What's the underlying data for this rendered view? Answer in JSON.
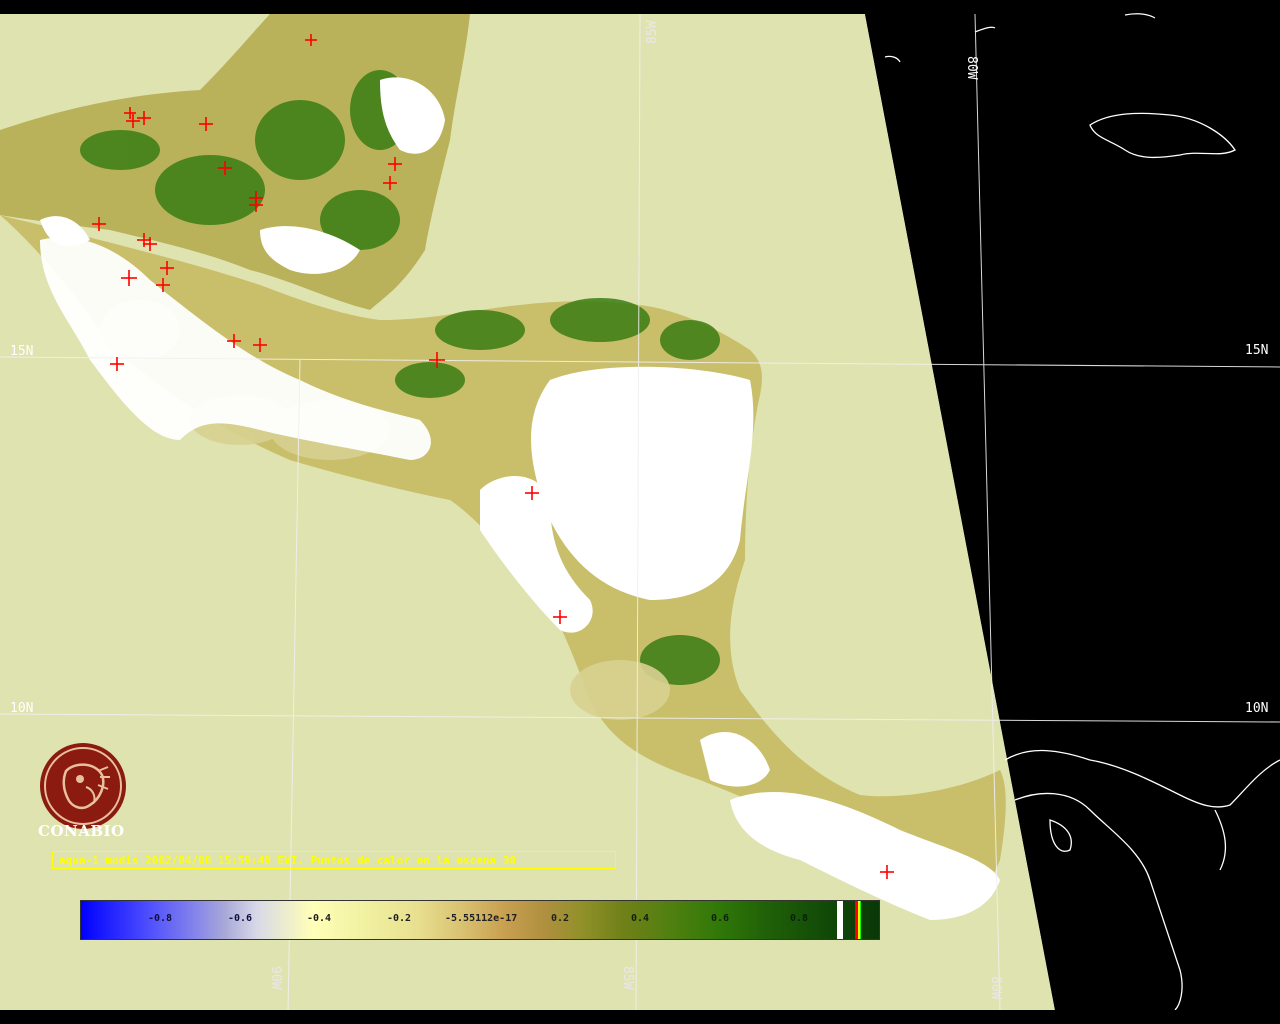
{
  "map": {
    "grid_labels": {
      "lat_15_left": "15N",
      "lat_15_right": "15N",
      "lat_10_left": "10N",
      "lat_10_right": "10N",
      "lon_85_top": "85W",
      "lon_80_top": "80W",
      "lon_90_bottom": "90W",
      "lon_85_bottom": "85W",
      "lon_80_bottom": "80W"
    },
    "colors": {
      "ocean_swath": "#dfe3b0",
      "outside_swath": "#000000",
      "cloud": "#ffffff",
      "vegetation_dark": "#2e7a10",
      "vegetation_light": "#c8c070",
      "hotspot_marker": "#ff0000",
      "coastline_outside": "#ffffff",
      "caption": "#ffff00"
    },
    "hotspots_count_shown": 28
  },
  "logo": {
    "name": "CONABIO",
    "brand_color": "#8b1a10"
  },
  "caption": {
    "text": "aqua-1 modis 2002/04/08 15:59:49 EVI. Puntos de calor en la escena 38"
  },
  "colorbar": {
    "ticks": [
      "-0.8",
      "-0.6",
      "-0.4",
      "-0.2",
      "-5.55112e-17",
      "0.2",
      "0.4",
      "0.6",
      "0.8"
    ],
    "range": [
      -1,
      1
    ],
    "legend_extra_colors": [
      "#ffffff",
      "#ff0000",
      "#ffff00",
      "#00ff00"
    ]
  }
}
